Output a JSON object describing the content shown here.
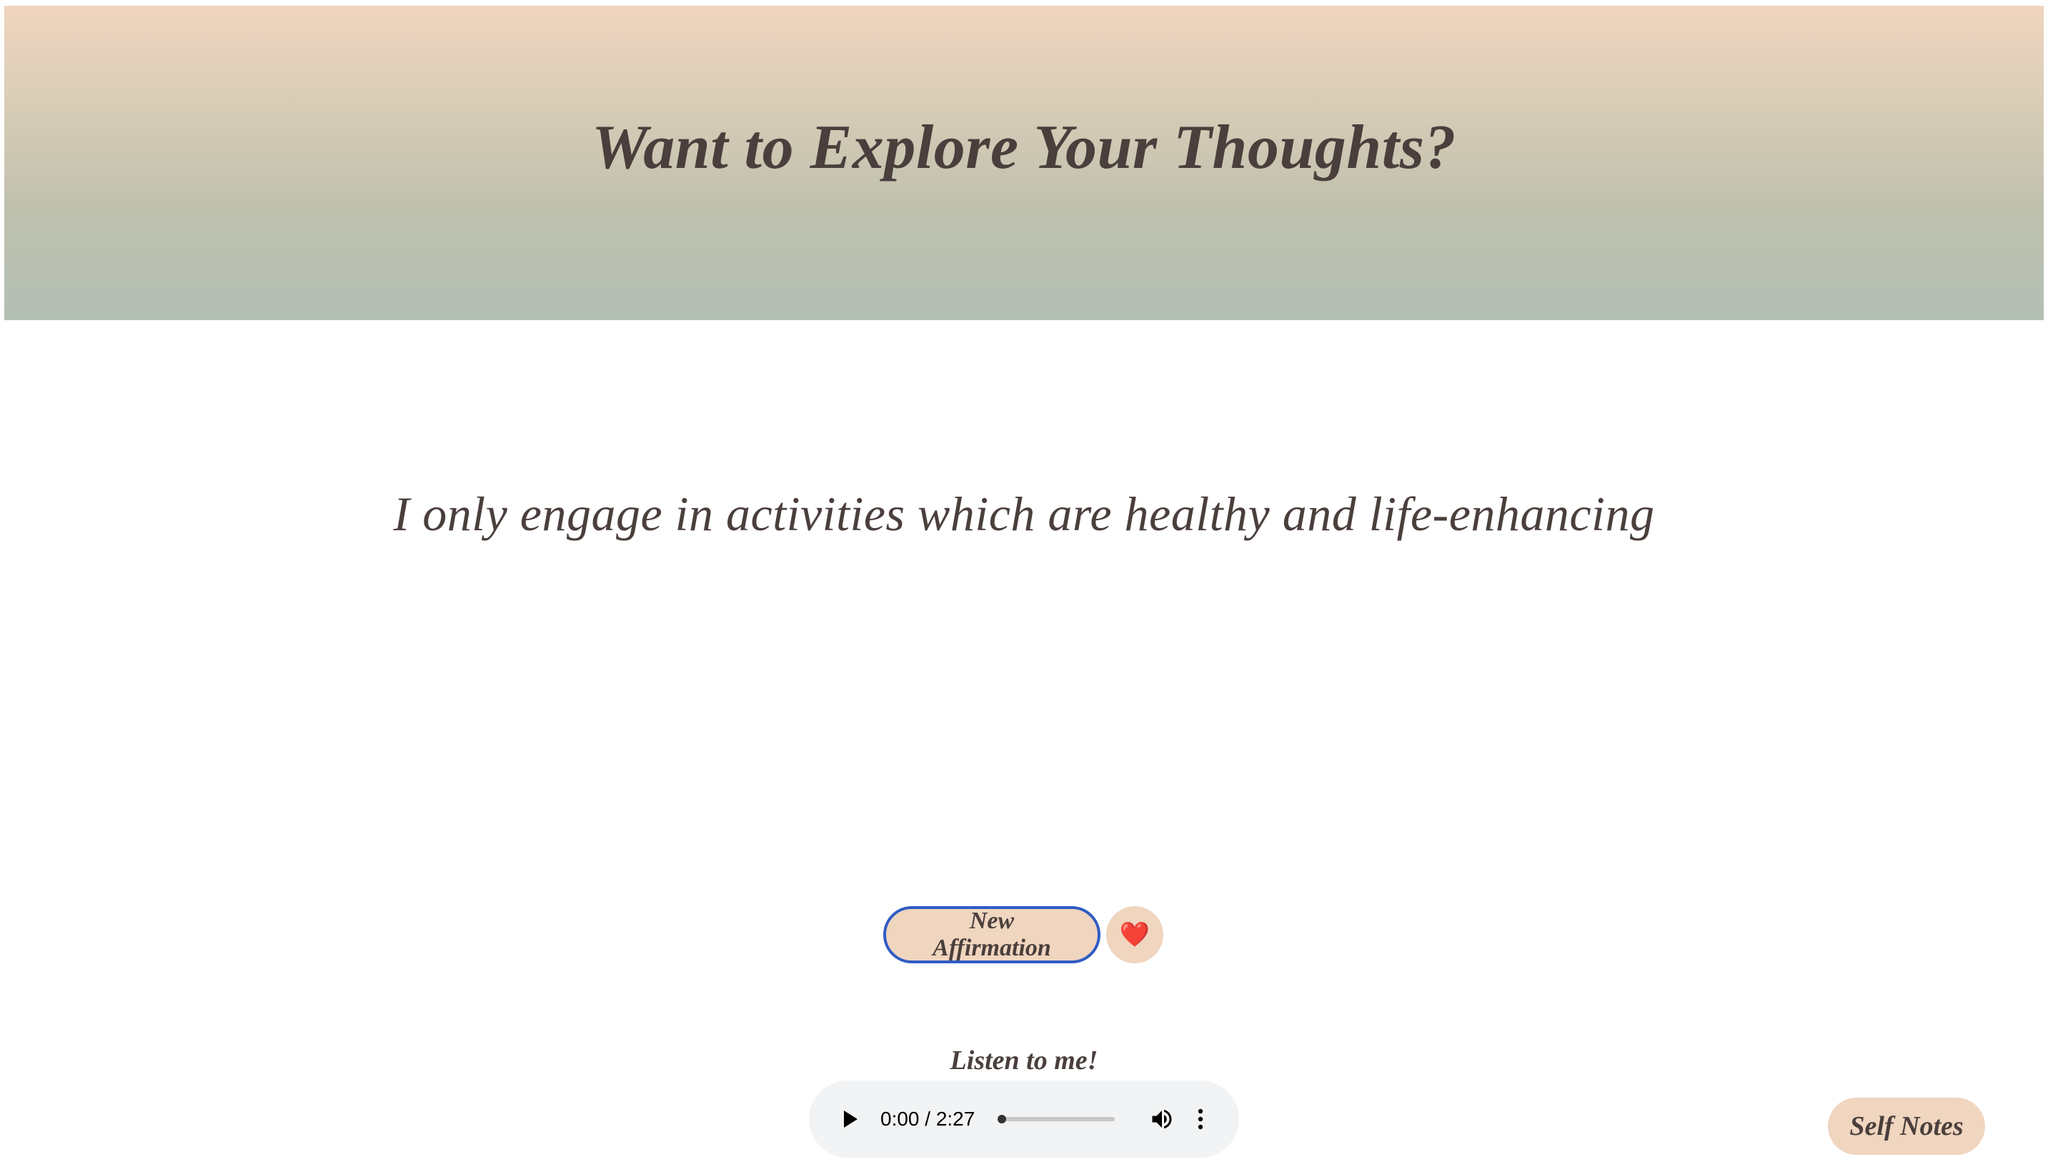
{
  "header": {
    "title": "Want to Explore Your Thoughts?"
  },
  "main": {
    "affirmation": "I only engage in activities which are healthy and life-enhancing",
    "new_affirmation_label": "New Affirmation",
    "favorite_icon": "heart-icon",
    "favorite_glyph": "❤️"
  },
  "audio": {
    "label": "Listen to me!",
    "time_display": "0:00 / 2:27",
    "current_time": "0:00",
    "duration": "2:27",
    "progress": 0,
    "play_icon": "play-icon",
    "volume_icon": "volume-icon",
    "more_icon": "more-vertical-icon"
  },
  "nav": {
    "self_notes_label": "Self Notes"
  },
  "colors": {
    "accent": "#f0d5bf",
    "text": "#4a3f3c",
    "focus_ring": "#2f5cc4",
    "hero_top": "#f0d5bf",
    "hero_bottom": "#b3bfb4"
  }
}
